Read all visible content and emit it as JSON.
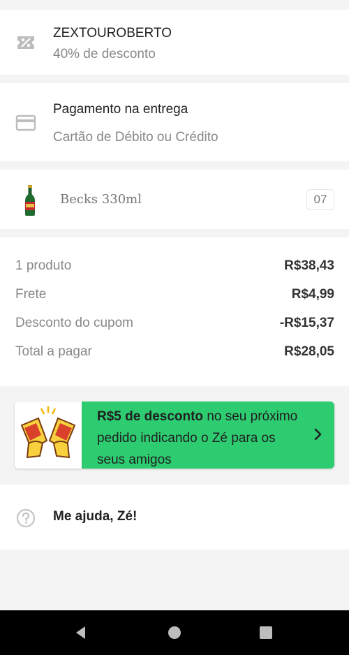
{
  "coupon": {
    "code": "ZEXTOUROBERTO",
    "discount": "40% de desconto",
    "icon": "coupon-icon"
  },
  "payment": {
    "title": "Pagamento na entrega",
    "method": "Cartão de Débito ou Crédito",
    "icon": "credit-card-icon"
  },
  "product": {
    "name": "Becks 330ml",
    "quantity": "07",
    "icon": "beer-bottle-icon"
  },
  "summary": {
    "rows": [
      {
        "label": "1 produto",
        "value": "R$38,43"
      },
      {
        "label": "Frete",
        "value": "R$4,99"
      },
      {
        "label": "Desconto do cupom",
        "value": "-R$15,37"
      },
      {
        "label": "Total a pagar",
        "value": "R$28,05"
      }
    ]
  },
  "promo": {
    "highlight": "R$5 de desconto",
    "text": " no seu próximo pedido indicando o Zé para os seus amigos",
    "accent_color": "#2ecc71",
    "icon": "cheers-icon"
  },
  "help": {
    "label": "Me ajuda, Zé!",
    "icon": "help-circle-icon"
  },
  "navbar": {
    "back_icon": "back-triangle-icon",
    "home_icon": "home-circle-icon",
    "recent_icon": "recent-square-icon"
  }
}
